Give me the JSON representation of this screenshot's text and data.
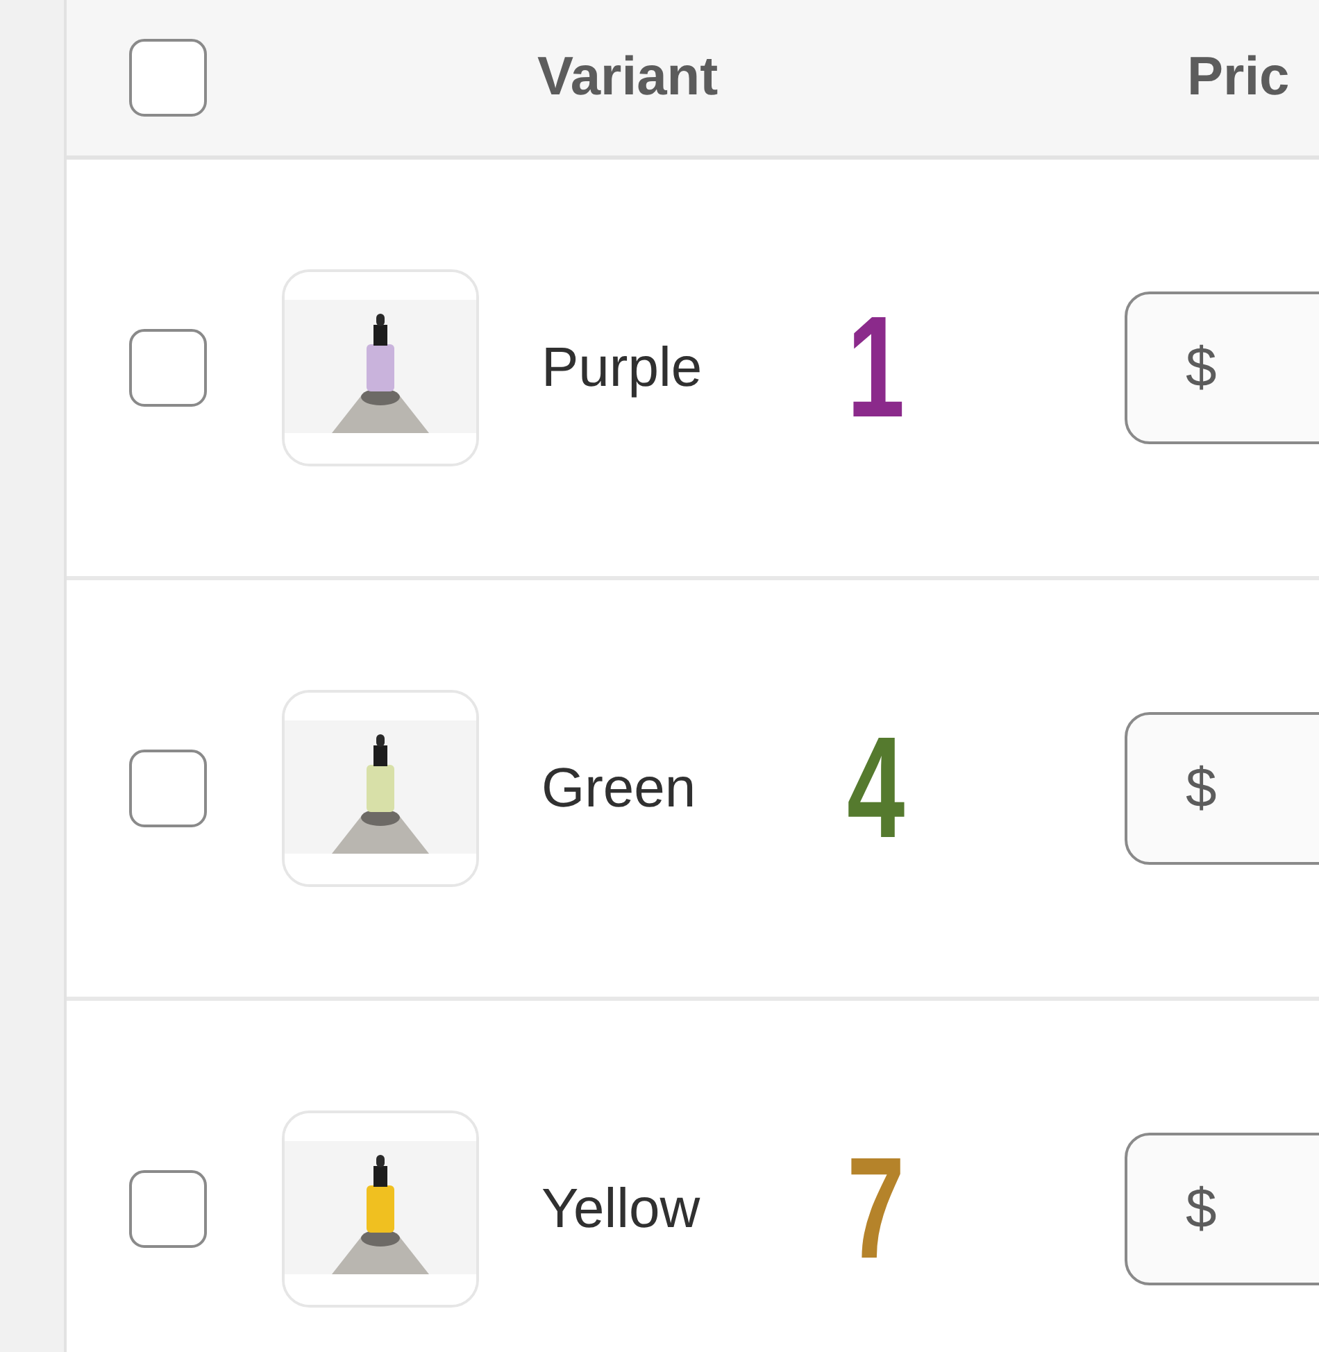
{
  "table": {
    "header": {
      "select_all": {
        "checked": false
      },
      "columns": [
        "Variant",
        "Pric"
      ]
    },
    "rows": [
      {
        "checked": false,
        "name": "Purple",
        "number": "1",
        "color": "#8b2a8b",
        "price_prefix": "$"
      },
      {
        "checked": false,
        "name": "Green",
        "number": "4",
        "color": "#557a2e",
        "price_prefix": "$"
      },
      {
        "checked": false,
        "name": "Yellow",
        "number": "7",
        "color": "#b5832a",
        "price_prefix": "$"
      }
    ]
  }
}
